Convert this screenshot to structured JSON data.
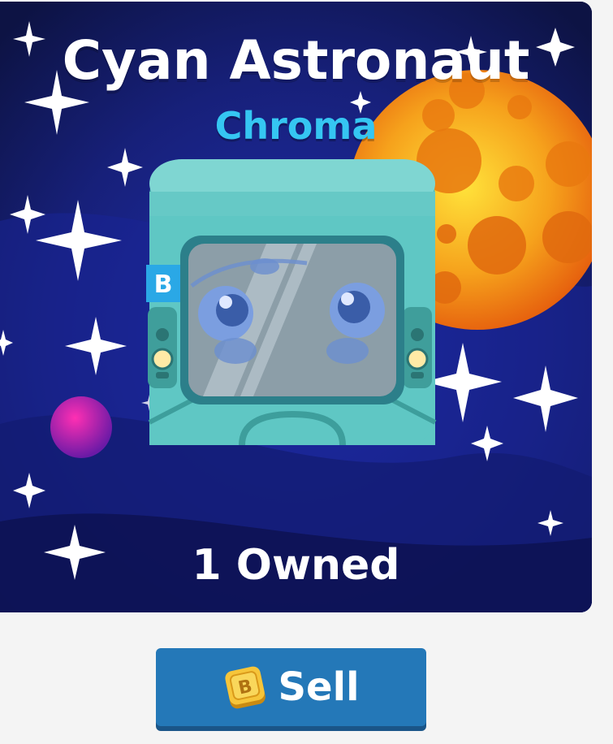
{
  "item": {
    "name": "Cyan Astronaut",
    "rarity": "Chroma",
    "owned_text": "1 Owned",
    "badge_letter": "B"
  },
  "actions": {
    "sell_label": "Sell",
    "sell_icon": "token-coin-icon"
  },
  "colors": {
    "card_bg": "#101a5e",
    "rarity_text": "#35c6f2",
    "button_bg": "#2478b8",
    "blook_body": "#5fc7c4"
  }
}
